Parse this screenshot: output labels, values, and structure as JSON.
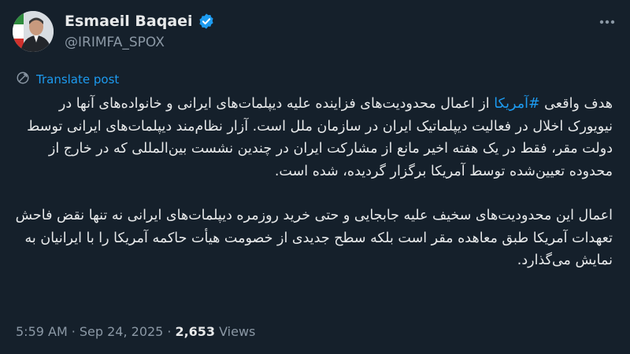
{
  "author": {
    "name": "Esmaeil Baqaei",
    "handle": "@IRIMFA_SPOX",
    "verified_color": "#1d9bf0",
    "avatar_icon": "profile-photo-with-iran-flag"
  },
  "translate_label": "Translate post",
  "post": {
    "p1_before": "هدف واقعی ",
    "hashtag": "#آمریکا",
    "p1_after": " از اعمال محدودیت‌های فزاینده علیه دیپلمات‌های ایرانی و خانواده‌های آنها در نیویورک اخلال در فعالیت دیپلماتیک ایران در سازمان ملل است. آزار نظام‌مند دیپلمات‌های ایرانی توسط دولت مقر، فقط در یک هفته اخیر مانع از مشارکت ایران در چندین نشست بین‌المللی که در خارج از محدوده تعیین‌شده توسط آمریکا برگزار گردیده، شده است.",
    "p2": "اعمال این محدودیت‌های سخیف علیه جابجایی و حتی خرید روزمره دیپلمات‌های ایرانی نه تنها نقض فاحش تعهدات آمریکا طبق معاهده مقر است بلکه سطح جدیدی از خصومت هیأت حاکمه آمریکا را با ایرانیان به نمایش می‌گذارد."
  },
  "meta": {
    "time": "5:59 AM",
    "sep1": "·",
    "date": "Sep 24, 2025",
    "sep2": "·",
    "views_count": "2,653",
    "views_label": "Views"
  },
  "colors": {
    "background": "#15202b",
    "link": "#1d9bf0",
    "secondary_text": "#8b98a5"
  }
}
